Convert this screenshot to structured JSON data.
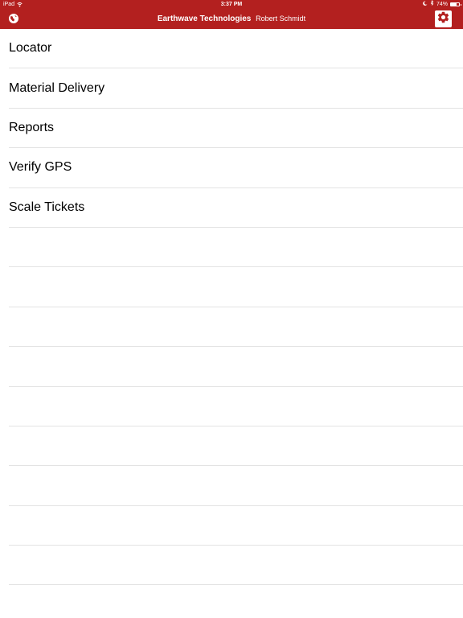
{
  "status_bar": {
    "device": "iPad",
    "time": "3:37 PM",
    "battery_text": "74%",
    "battery_level": 0.74
  },
  "nav_bar": {
    "organization": "Earthwave Technologies",
    "user": "Robert Schmidt",
    "left_icon": "globe-icon",
    "right_icon": "gear-icon"
  },
  "colors": {
    "header_bg": "#b3201f",
    "separator": "#e3e3e3"
  },
  "menu": {
    "items": [
      {
        "label": "Locator"
      },
      {
        "label": "Material Delivery"
      },
      {
        "label": "Reports"
      },
      {
        "label": "Verify GPS"
      },
      {
        "label": "Scale Tickets"
      }
    ],
    "empty_rows": 10
  }
}
